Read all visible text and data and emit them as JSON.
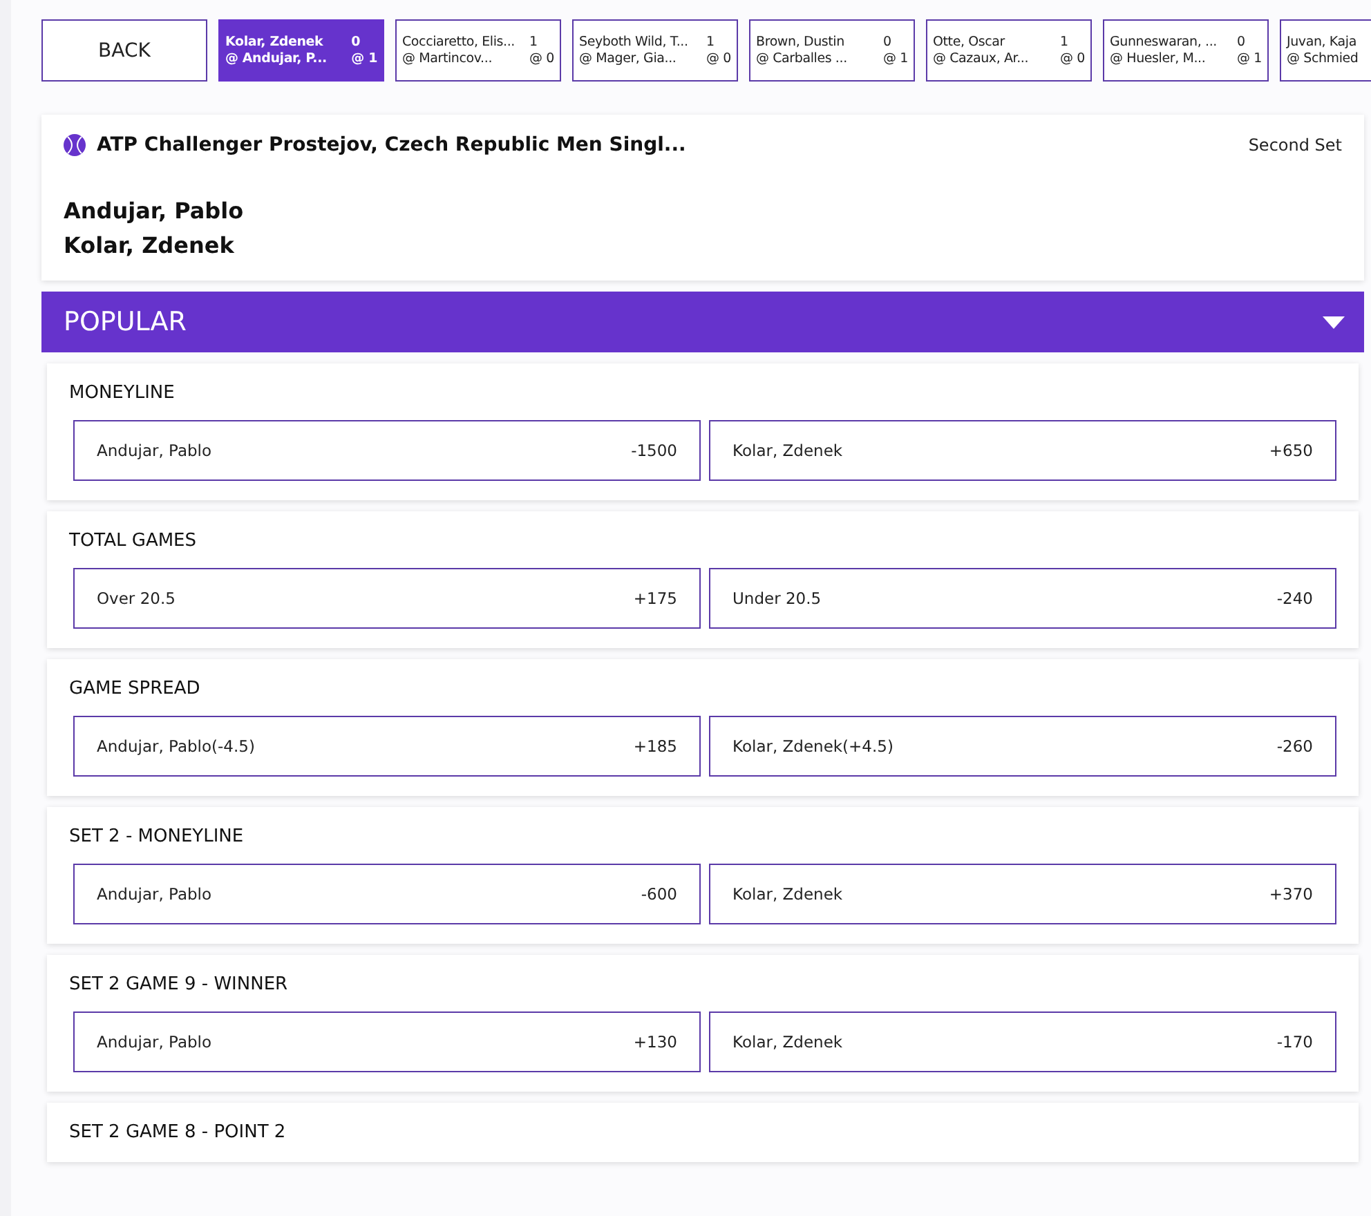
{
  "back_button": "BACK",
  "matches": [
    {
      "home": "Kolar, Zdenek",
      "home_score": "0",
      "away": "@ Andujar, P...",
      "away_score": "@ 1",
      "selected": true
    },
    {
      "home": "Cocciaretto, Elis...",
      "home_score": "1",
      "away": "@ Martincov...",
      "away_score": "@ 0",
      "selected": false
    },
    {
      "home": "Seyboth Wild, T...",
      "home_score": "1",
      "away": "@ Mager, Gia...",
      "away_score": "@ 0",
      "selected": false
    },
    {
      "home": "Brown, Dustin",
      "home_score": "0",
      "away": "@ Carballes ...",
      "away_score": "@ 1",
      "selected": false
    },
    {
      "home": "Otte, Oscar",
      "home_score": "1",
      "away": "@ Cazaux, Ar...",
      "away_score": "@ 0",
      "selected": false
    },
    {
      "home": "Gunneswaran, ...",
      "home_score": "0",
      "away": "@ Huesler, M...",
      "away_score": "@ 1",
      "selected": false
    },
    {
      "home": "Juvan, Kaja",
      "away": "@ Schmied",
      "selected": false
    }
  ],
  "event": {
    "title": "ATP Challenger Prostejov, Czech Republic Men Singl...",
    "period": "Second Set",
    "players": [
      "Andujar, Pablo",
      "Kolar, Zdenek"
    ]
  },
  "section": {
    "title": "POPULAR",
    "expanded": true
  },
  "markets": [
    {
      "title": "MONEYLINE",
      "options": [
        {
          "label": "Andujar, Pablo",
          "odds": "-1500"
        },
        {
          "label": "Kolar, Zdenek",
          "odds": "+650"
        }
      ]
    },
    {
      "title": "TOTAL GAMES",
      "options": [
        {
          "label": "Over 20.5",
          "odds": "+175"
        },
        {
          "label": "Under 20.5",
          "odds": "-240"
        }
      ]
    },
    {
      "title": "GAME SPREAD",
      "options": [
        {
          "label": "Andujar, Pablo(-4.5)",
          "odds": "+185"
        },
        {
          "label": "Kolar, Zdenek(+4.5)",
          "odds": "-260"
        }
      ]
    },
    {
      "title": "SET 2 - MONEYLINE",
      "options": [
        {
          "label": "Andujar, Pablo",
          "odds": "-600"
        },
        {
          "label": "Kolar, Zdenek",
          "odds": "+370"
        }
      ]
    },
    {
      "title": "SET 2 GAME 9 - WINNER",
      "options": [
        {
          "label": "Andujar, Pablo",
          "odds": "+130"
        },
        {
          "label": "Kolar, Zdenek",
          "odds": "-170"
        }
      ]
    },
    {
      "title": "SET 2 GAME 8 - POINT 2"
    }
  ]
}
